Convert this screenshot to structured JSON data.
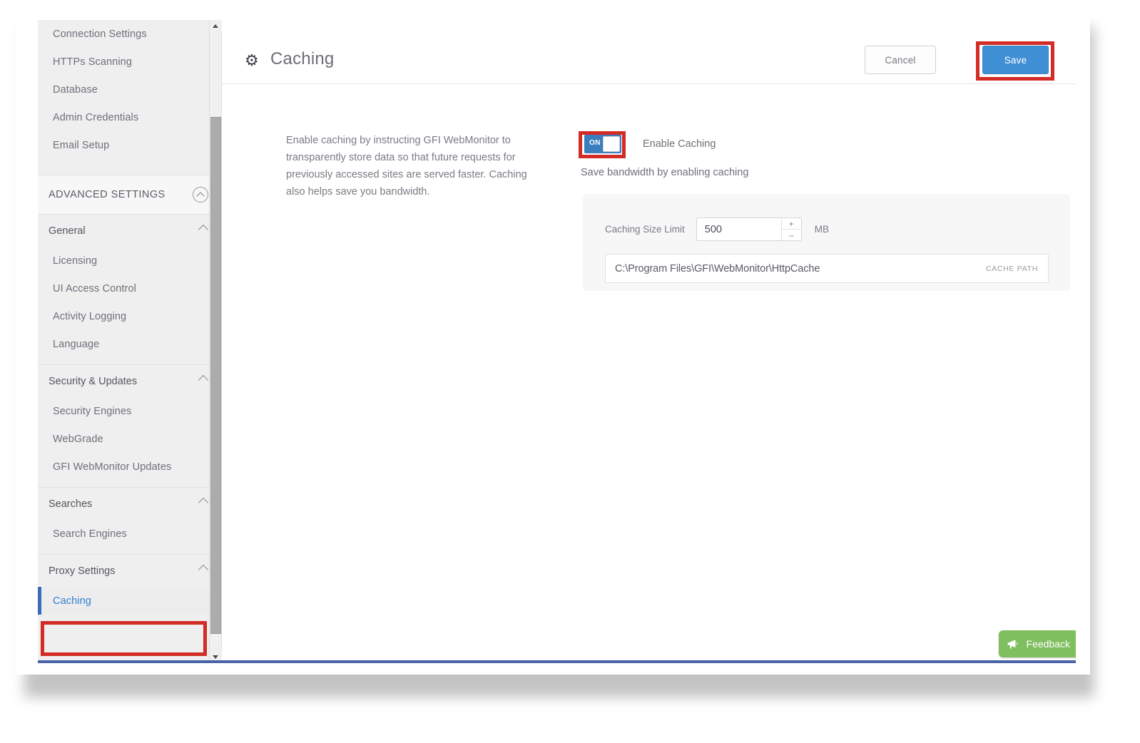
{
  "window": {
    "accent_bottom_border": "#4a63a8",
    "highlight_color": "#d32b25"
  },
  "sidebar": {
    "top_items": [
      {
        "label": "Connection Settings"
      },
      {
        "label": "HTTPs Scanning"
      },
      {
        "label": "Database"
      },
      {
        "label": "Admin Credentials"
      },
      {
        "label": "Email Setup"
      }
    ],
    "advanced_banner": {
      "label": "ADVANCED SETTINGS",
      "collapse_icon": "chevron-up-circle-icon"
    },
    "groups": [
      {
        "label": "General",
        "collapse_icon": "chevron-up-icon",
        "items": [
          {
            "label": "Licensing",
            "selected": false
          },
          {
            "label": "UI Access Control",
            "selected": false
          },
          {
            "label": "Activity Logging",
            "selected": false
          },
          {
            "label": "Language",
            "selected": false
          }
        ]
      },
      {
        "label": "Security & Updates",
        "collapse_icon": "chevron-up-icon",
        "items": [
          {
            "label": "Security Engines",
            "selected": false
          },
          {
            "label": "WebGrade",
            "selected": false
          },
          {
            "label": "GFI WebMonitor Updates",
            "selected": false
          }
        ]
      },
      {
        "label": "Searches",
        "collapse_icon": "chevron-up-icon",
        "items": [
          {
            "label": "Search Engines",
            "selected": false
          }
        ]
      },
      {
        "label": "Proxy Settings",
        "collapse_icon": "chevron-up-icon",
        "items": [
          {
            "label": "Caching",
            "selected": true
          }
        ]
      }
    ],
    "scrollbar": {
      "up_arrow": "triangle-up-icon",
      "down_arrow": "triangle-down-icon"
    }
  },
  "header": {
    "icon": "gear-icon",
    "gear_glyph": "⚙",
    "title": "Caching",
    "cancel_label": "Cancel",
    "save_label": "Save",
    "save_color": "#3e8fd4"
  },
  "main": {
    "description": "Enable caching by instructing GFI WebMonitor to transparently store data so that future requests for previously accessed sites are served faster. Caching also helps save you bandwidth.",
    "toggle": {
      "state_label": "ON",
      "enabled": true,
      "label": "Enable Caching",
      "sublabel": "Save bandwidth by enabling caching",
      "on_color": "#3a7ebf"
    },
    "settings": {
      "size_limit_label": "Caching Size Limit",
      "size_limit_value": "500",
      "size_limit_unit": "MB",
      "spinner_up": "+",
      "spinner_down": "–",
      "cache_path_value": "C:\\Program Files\\GFI\\WebMonitor\\HttpCache",
      "cache_path_tag": "CACHE PATH"
    }
  },
  "feedback": {
    "label": "Feedback",
    "icon": "megaphone-icon",
    "color": "#7fbf5f"
  }
}
